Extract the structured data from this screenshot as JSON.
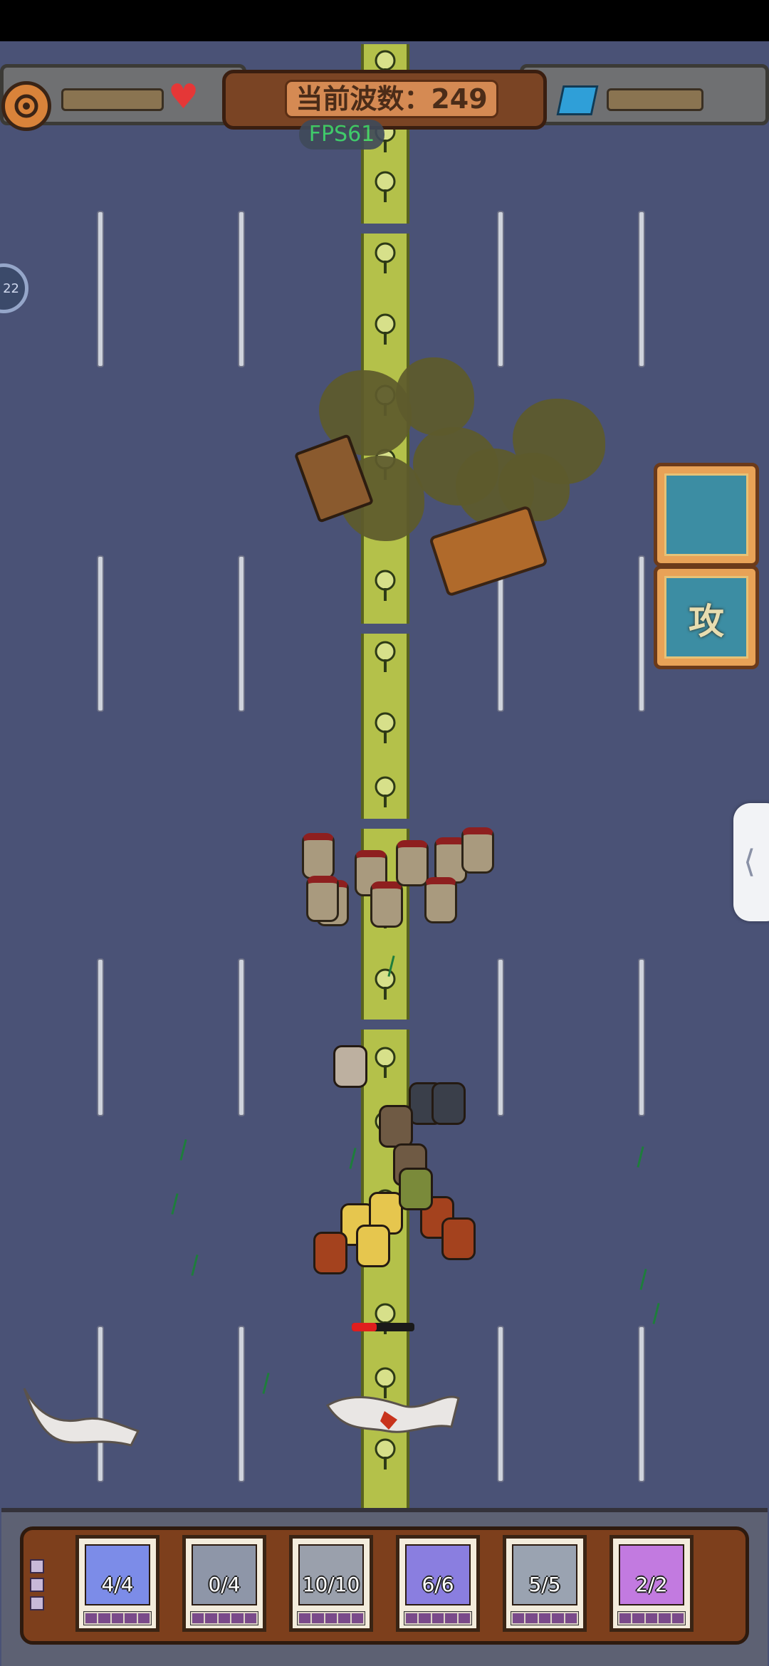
{
  "hud": {
    "wave_label": "当前波数：249",
    "fps_label": "FPS61",
    "side_indicator": "22",
    "attack_label": "攻"
  },
  "icons": {
    "settings": "gear-icon",
    "life": "heart-icon",
    "resource": "gem-icon",
    "side_tab": "chevron-left-icon"
  },
  "colors": {
    "field": "#4a5276",
    "median": "#b4c14a",
    "hud_wood": "#7a4424",
    "fps_text": "#3fd76a"
  },
  "units": [
    {
      "count": "4/4",
      "portrait_color": "#7c8ce8"
    },
    {
      "count": "0/4",
      "portrait_color": "#8e96a8"
    },
    {
      "count": "10/10",
      "portrait_color": "#9aa0ac"
    },
    {
      "count": "6/6",
      "portrait_color": "#8a7ee0"
    },
    {
      "count": "5/5",
      "portrait_color": "#9aa3b1"
    },
    {
      "count": "2/2",
      "portrait_color": "#c27ae0"
    }
  ]
}
